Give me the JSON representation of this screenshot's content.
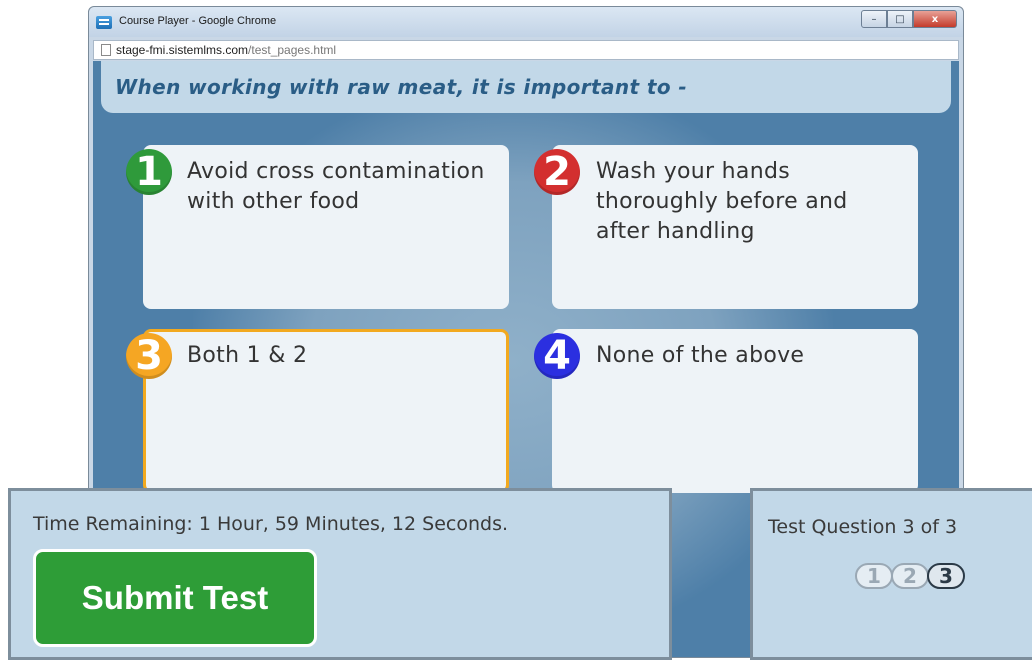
{
  "window": {
    "title": "Course Player - Google Chrome",
    "url_host": "stage-fmi.sistemlms.com",
    "url_path": "/test_pages.html",
    "controls": {
      "minimize": "–",
      "maximize": "□",
      "close": "x"
    }
  },
  "question": {
    "text": "When working with raw meat, it is important to -"
  },
  "answers": [
    {
      "number": "1",
      "text": "Avoid cross contamination with other food",
      "badge_color": "#2f9a3b",
      "selected": false
    },
    {
      "number": "2",
      "text": "Wash your hands thoroughly before and after handling",
      "badge_color": "#d32f2f",
      "selected": false
    },
    {
      "number": "3",
      "text": "Both 1 & 2",
      "badge_color": "#f5a623",
      "selected": true
    },
    {
      "number": "4",
      "text": "None of the above",
      "badge_color": "#2b2fe0",
      "selected": false
    }
  ],
  "footer": {
    "time_remaining": "Time Remaining: 1 Hour, 59 Minutes, 12 Seconds.",
    "submit_label": "Submit Test",
    "test_question": "Test Question 3 of 3",
    "pages": [
      "1",
      "2",
      "3"
    ],
    "current_page": "3"
  },
  "colors": {
    "content_bg": "#4e7fa8",
    "question_bar": "#c2d8e8",
    "question_text": "#2a5d86",
    "selected_border": "#f2a91f",
    "submit_bg": "#2e9d37"
  }
}
